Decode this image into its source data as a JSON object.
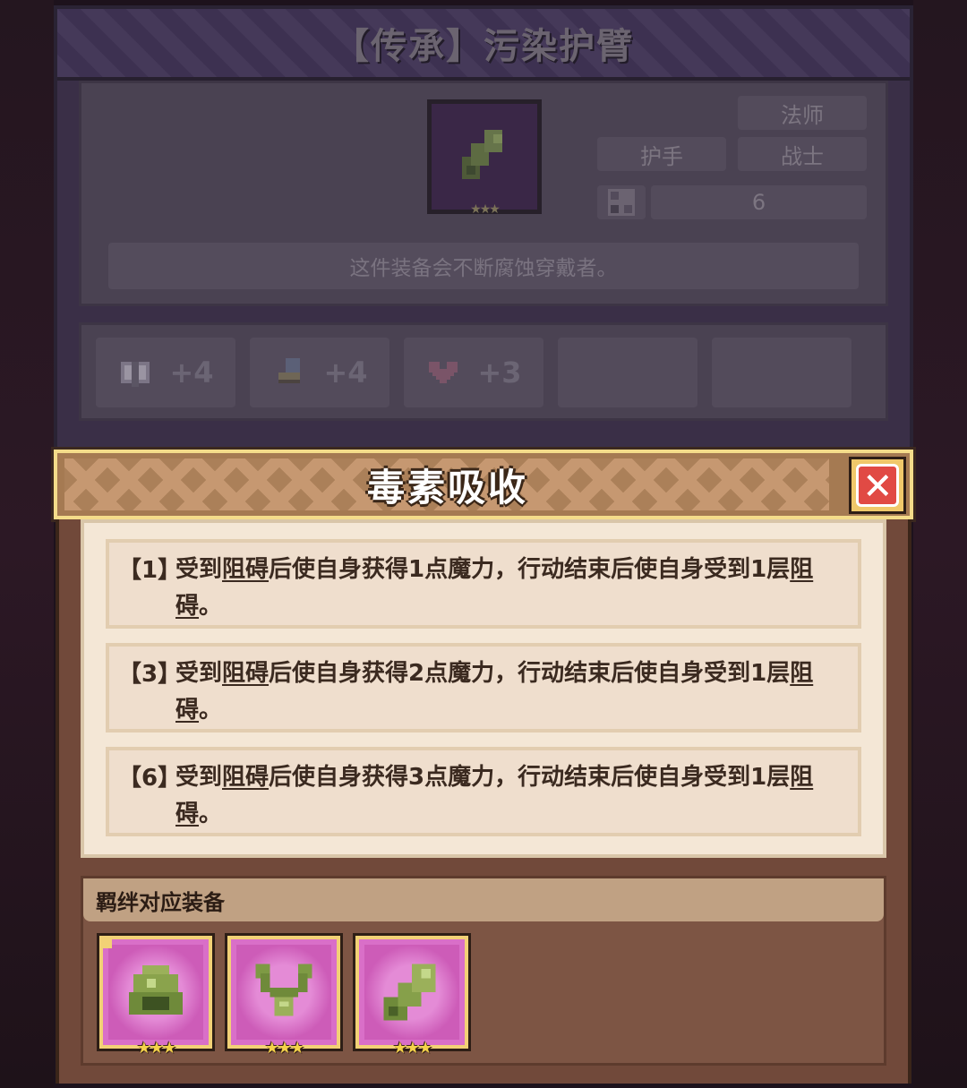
{
  "item": {
    "title": "【传承】污染护臂",
    "tags": {
      "type": "护手",
      "class_1": "法师",
      "class_2": "战士"
    },
    "slot_value": "6",
    "description": "这件装备会不断腐蚀穿戴者。",
    "stats": [
      {
        "icon": "spellbook-icon",
        "value": "+4"
      },
      {
        "icon": "boot-icon",
        "value": "+4"
      },
      {
        "icon": "heart-icon",
        "value": "+3"
      }
    ]
  },
  "modal": {
    "title": "毒素吸收",
    "effects": [
      {
        "level": "【1】",
        "pre": "受到",
        "keyword": "阻碍",
        "mid": "后使自身获得1点魔力，行动结束后使自身受到1层",
        "keyword2": "阻碍",
        "end": "。"
      },
      {
        "level": "【3】",
        "pre": "受到",
        "keyword": "阻碍",
        "mid": "后使自身获得2点魔力，行动结束后使自身受到1层",
        "keyword2": "阻碍",
        "end": "。"
      },
      {
        "level": "【6】",
        "pre": "受到",
        "keyword": "阻碍",
        "mid": "后使自身获得3点魔力，行动结束后使自身受到1层",
        "keyword2": "阻碍",
        "end": "。"
      }
    ],
    "bond_header": "羁绊对应装备",
    "bond_items": [
      {
        "icon": "slime-ring-icon",
        "stars": "★★★"
      },
      {
        "icon": "slime-necklace-icon",
        "stars": "★★★"
      },
      {
        "icon": "polluted-bracer-icon",
        "stars": "★★★"
      }
    ]
  },
  "colors": {
    "accent_gold": "#f2d176",
    "close_red": "#e14a44",
    "item_rarity_purple": "#d96fc8"
  }
}
